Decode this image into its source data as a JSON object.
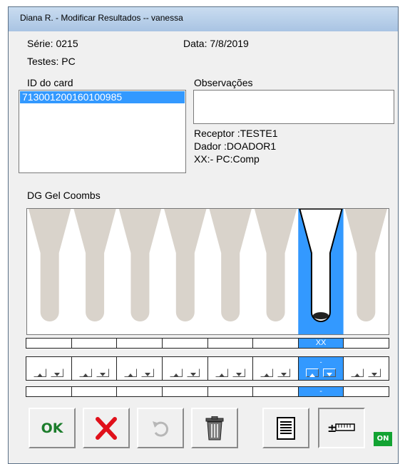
{
  "window": {
    "title": "Diana R. - Modificar Resultados -- vanessa"
  },
  "info": {
    "serie": "Série: 0215",
    "data": "Data: 7/8/2019",
    "testes": "Testes: PC"
  },
  "card": {
    "label": "ID do card",
    "items": [
      "713001200160100985"
    ]
  },
  "observacoes": {
    "label": "Observações",
    "value": "",
    "receptor": "Receptor :TESTE1",
    "dador": "Dador  :DOADOR1",
    "xx": "XX:-   PC:Comp"
  },
  "gel": {
    "label": "DG Gel Coombs",
    "well_count": 8,
    "selected_well": 7,
    "result_labels": [
      "",
      "",
      "",
      "",
      "",
      "",
      "XX",
      ""
    ],
    "arrow_labels": [
      "",
      "",
      "",
      "",
      "",
      "",
      "-",
      ""
    ],
    "bottom_labels": [
      "",
      "",
      "",
      "",
      "",
      "",
      "-",
      ""
    ]
  },
  "toolbar": {
    "ok_label": "OK",
    "on_badge": "ON"
  },
  "colors": {
    "selection": "#3399ff",
    "ok_green": "#1c7d2c",
    "cancel_red": "#e0101a",
    "on_badge": "#12a332",
    "well_beige": "#d9d3cb"
  },
  "icons": {
    "ok": "ok-text-icon",
    "cancel": "red-x-icon",
    "undo": "undo-icon",
    "delete": "trash-icon",
    "report": "document-list-icon",
    "adjust": "plus-minus-ruler-icon"
  }
}
